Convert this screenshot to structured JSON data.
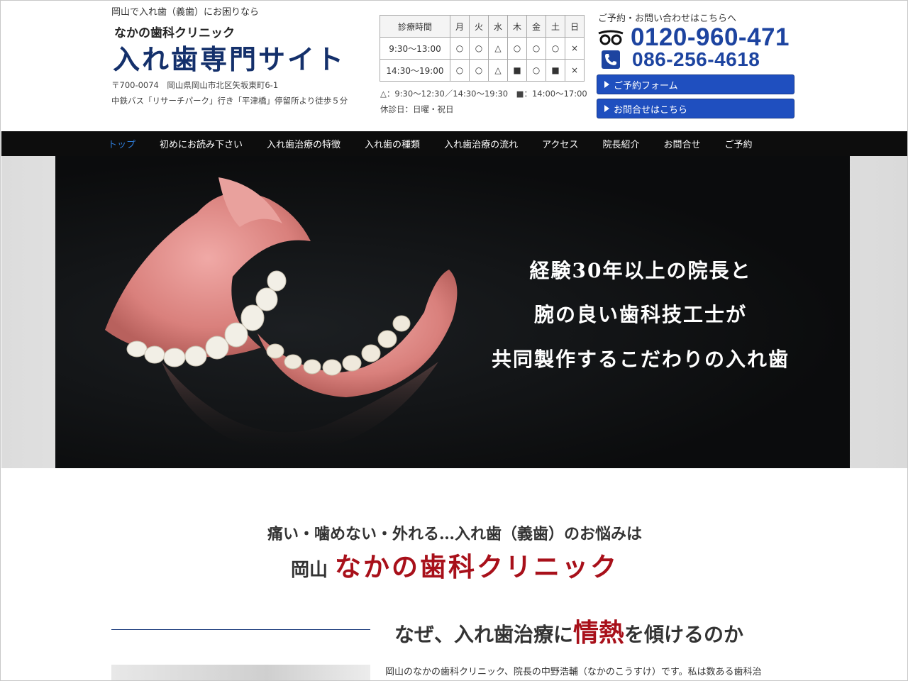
{
  "header": {
    "tagline": "岡山で入れ歯（義歯）にお困りなら",
    "logo_sub": "なかの歯科クリニック",
    "logo_main": "入れ歯専門サイト",
    "address1": "〒700-0074　岡山県岡山市北区矢坂東町6-1",
    "address2": "中鉄バス「リサーチパーク」行き「平津橋」停留所より徒歩５分"
  },
  "hours": {
    "head": "診療時間",
    "days": [
      "月",
      "火",
      "水",
      "木",
      "金",
      "土",
      "日"
    ],
    "rows": [
      {
        "time": "9:30〜13:00",
        "marks": [
          "○",
          "○",
          "△",
          "○",
          "○",
          "○",
          "×"
        ]
      },
      {
        "time": "14:30〜19:00",
        "marks": [
          "○",
          "○",
          "△",
          "■",
          "○",
          "■",
          "×"
        ]
      }
    ],
    "note1": "△：9:30〜12:30／14:30〜19:30　■：14:00〜17:00",
    "note2": "休診日：日曜・祝日"
  },
  "contact": {
    "lead": "ご予約・お問い合わせはこちらへ",
    "freedial": "0120-960-471",
    "phone": "086-256-4618",
    "reserve_button": "ご予約フォーム",
    "inquiry_button": "お問合せはこちら",
    "accent": "#1d44a0"
  },
  "nav": [
    "トップ",
    "初めにお読み下さい",
    "入れ歯治療の特徴",
    "入れ歯の種類",
    "入れ歯治療の流れ",
    "アクセス",
    "院長紹介",
    "お問合せ",
    "ご予約"
  ],
  "hero": {
    "line1": "経験30年以上の院長と",
    "line2": "腕の良い歯科技工士が",
    "line3": "共同製作するこだわりの入れ歯"
  },
  "intro": {
    "line1": "痛い・噛めない・外れる…入れ歯（義歯）のお悩みは",
    "prefix": "岡山",
    "clinic": "なかの歯科クリニック"
  },
  "why": {
    "pre": "なぜ、入れ歯治療に",
    "emphasis": "情熱",
    "post": "を傾けるのか"
  },
  "body_text": "岡山のなかの歯科クリニック、院長の中野浩輔（なかのこうすけ）です。私は数ある歯科治",
  "brand_red": "#a8101a"
}
